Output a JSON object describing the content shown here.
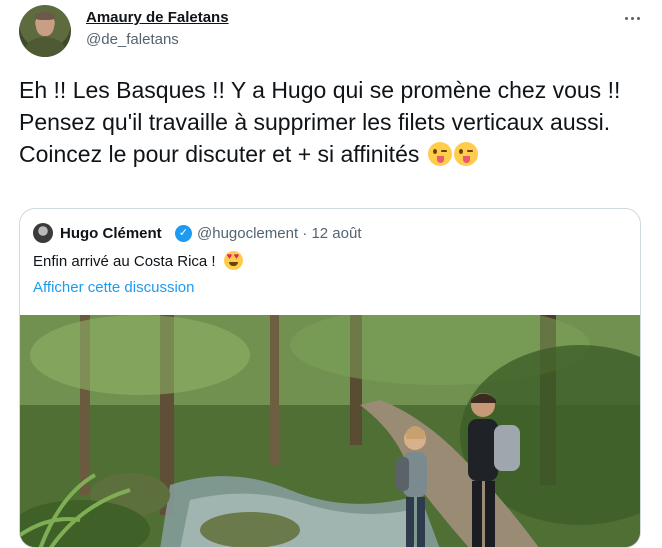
{
  "tweet": {
    "author_name": "Amaury de Faletans",
    "author_handle": "@de_faletans",
    "text": "Eh !! Les Basques !! Y a Hugo qui se promène chez vous !! Pensez qu'il travaille à supprimer les filets verticaux aussi. Coincez le pour discuter et + si affinités ",
    "emojis": [
      "winking-face-with-tongue",
      "winking-face-with-tongue"
    ]
  },
  "quoted_tweet": {
    "author_name": "Hugo Clément",
    "verified": true,
    "handle_date": "@hugoclement · 12 août",
    "text": "Enfin arrivé au Costa Rica ! ",
    "emoji": "smiling-face-with-heart-eyes",
    "show_thread_label": "Afficher cette discussion",
    "photo": "forest-trail-hikers"
  },
  "colors": {
    "text": "#0f1419",
    "secondary": "#536471",
    "link": "#1d9bf0",
    "border": "#cfd9de"
  }
}
